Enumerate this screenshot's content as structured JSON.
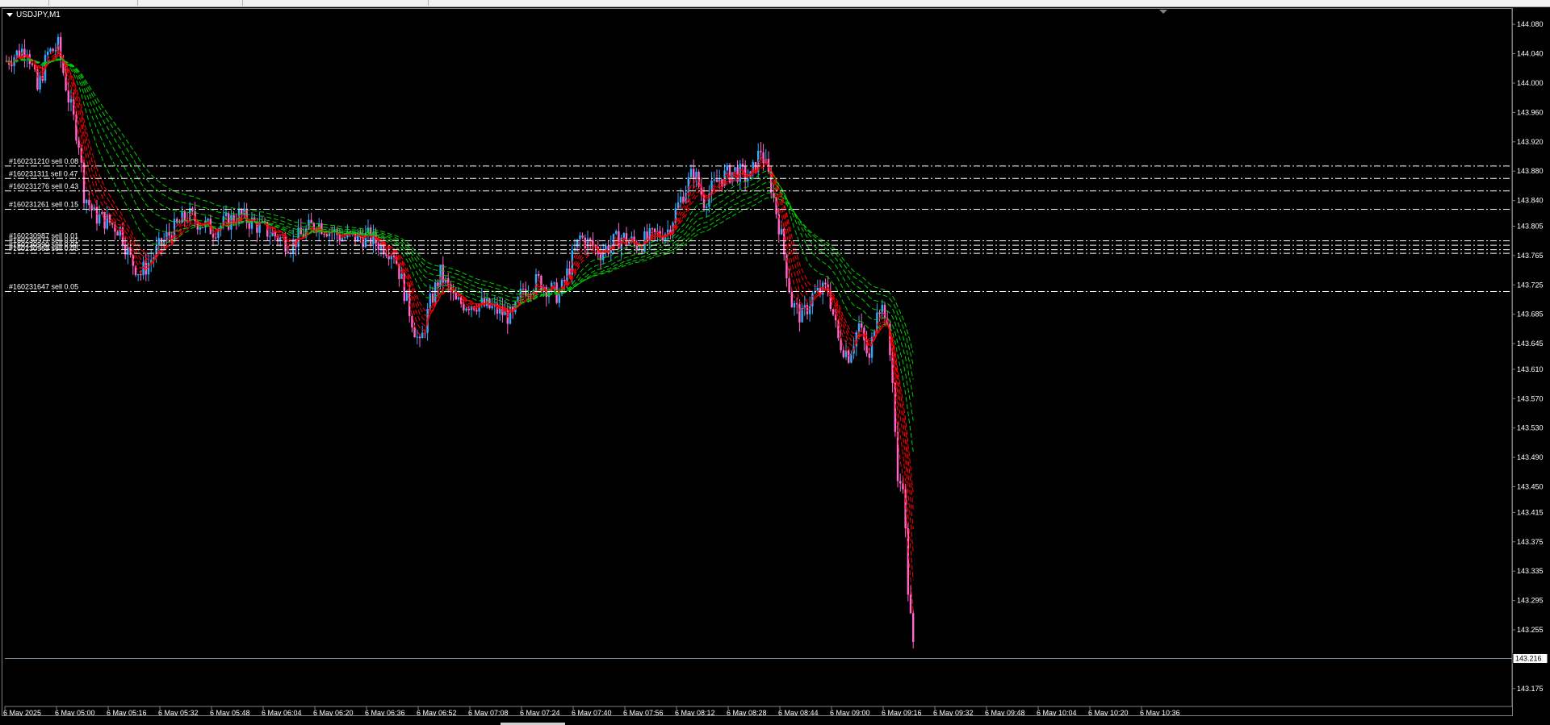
{
  "window": {
    "title": "USDJPY,M1"
  },
  "colors": {
    "background": "#000000",
    "bull": "#33aaff",
    "bear": "#ff66cc",
    "fast_ma": "#ff0000",
    "slow_ma": "#00cc00",
    "order_line": "#ffffff",
    "bid_line": "#778899"
  },
  "orders": [
    {
      "label": "#160231210 sell 0.08",
      "price": 143.887
    },
    {
      "label": "#160231311 sell 0.47",
      "price": 143.87
    },
    {
      "label": "#160231276 sell 0.43",
      "price": 143.853
    },
    {
      "label": "#160231261 sell 0.15",
      "price": 143.828
    },
    {
      "label": "#160230987 sell 0.01",
      "price": 143.785
    },
    {
      "label": "#160230977 sell 0.01",
      "price": 143.779
    },
    {
      "label": "#160230990 sell 0.04",
      "price": 143.773
    },
    {
      "label": "#160230969 sell 0.05",
      "price": 143.768
    },
    {
      "label": "#160231647 sell 0.05",
      "price": 143.716
    }
  ],
  "current_price": "143.216",
  "chart_data": {
    "type": "candlestick",
    "symbol": "USDJPY",
    "timeframe": "M1",
    "ylim": [
      143.155,
      144.1
    ],
    "y_ticks": [
      "144.080",
      "144.040",
      "144.000",
      "143.960",
      "143.920",
      "143.880",
      "143.840",
      "143.805",
      "143.765",
      "143.725",
      "143.685",
      "143.645",
      "143.610",
      "143.570",
      "143.530",
      "143.490",
      "143.450",
      "143.415",
      "143.375",
      "143.335",
      "143.295",
      "143.255",
      "143.175"
    ],
    "x_ticks": [
      "6 May 2025",
      "6 May 05:00",
      "6 May 05:16",
      "6 May 05:32",
      "6 May 05:48",
      "6 May 06:04",
      "6 May 06:20",
      "6 May 06:36",
      "6 May 06:52",
      "6 May 07:08",
      "6 May 07:24",
      "6 May 07:40",
      "6 May 07:56",
      "6 May 08:12",
      "6 May 08:28",
      "6 May 08:44",
      "6 May 09:00",
      "6 May 09:16",
      "6 May 09:32",
      "6 May 09:48",
      "6 May 10:04",
      "6 May 10:20",
      "6 May 10:36"
    ],
    "candle_count": 352,
    "close_path": [
      {
        "i": 0,
        "p": 144.03
      },
      {
        "i": 8,
        "p": 144.05
      },
      {
        "i": 12,
        "p": 143.99
      },
      {
        "i": 16,
        "p": 144.04
      },
      {
        "i": 20,
        "p": 144.05
      },
      {
        "i": 24,
        "p": 143.98
      },
      {
        "i": 28,
        "p": 143.92
      },
      {
        "i": 30,
        "p": 143.85
      },
      {
        "i": 34,
        "p": 143.82
      },
      {
        "i": 40,
        "p": 143.81
      },
      {
        "i": 44,
        "p": 143.8
      },
      {
        "i": 48,
        "p": 143.76
      },
      {
        "i": 52,
        "p": 143.74
      },
      {
        "i": 56,
        "p": 143.76
      },
      {
        "i": 62,
        "p": 143.79
      },
      {
        "i": 70,
        "p": 143.82
      },
      {
        "i": 80,
        "p": 143.8
      },
      {
        "i": 90,
        "p": 143.82
      },
      {
        "i": 100,
        "p": 143.8
      },
      {
        "i": 110,
        "p": 143.78
      },
      {
        "i": 120,
        "p": 143.81
      },
      {
        "i": 130,
        "p": 143.79
      },
      {
        "i": 140,
        "p": 143.79
      },
      {
        "i": 150,
        "p": 143.77
      },
      {
        "i": 156,
        "p": 143.69
      },
      {
        "i": 160,
        "p": 143.64
      },
      {
        "i": 164,
        "p": 143.7
      },
      {
        "i": 168,
        "p": 143.74
      },
      {
        "i": 174,
        "p": 143.7
      },
      {
        "i": 182,
        "p": 143.7
      },
      {
        "i": 190,
        "p": 143.69
      },
      {
        "i": 196,
        "p": 143.68
      },
      {
        "i": 200,
        "p": 143.72
      },
      {
        "i": 206,
        "p": 143.73
      },
      {
        "i": 214,
        "p": 143.71
      },
      {
        "i": 222,
        "p": 143.79
      },
      {
        "i": 230,
        "p": 143.77
      },
      {
        "i": 238,
        "p": 143.79
      },
      {
        "i": 244,
        "p": 143.78
      },
      {
        "i": 250,
        "p": 143.79
      },
      {
        "i": 256,
        "p": 143.8
      },
      {
        "i": 262,
        "p": 143.85
      },
      {
        "i": 266,
        "p": 143.88
      },
      {
        "i": 270,
        "p": 143.84
      },
      {
        "i": 276,
        "p": 143.87
      },
      {
        "i": 282,
        "p": 143.88
      },
      {
        "i": 288,
        "p": 143.87
      },
      {
        "i": 292,
        "p": 143.91
      },
      {
        "i": 296,
        "p": 143.86
      },
      {
        "i": 300,
        "p": 143.79
      },
      {
        "i": 304,
        "p": 143.7
      },
      {
        "i": 308,
        "p": 143.68
      },
      {
        "i": 312,
        "p": 143.71
      },
      {
        "i": 318,
        "p": 143.72
      },
      {
        "i": 322,
        "p": 143.65
      },
      {
        "i": 326,
        "p": 143.63
      },
      {
        "i": 330,
        "p": 143.67
      },
      {
        "i": 334,
        "p": 143.62
      },
      {
        "i": 337,
        "p": 143.7
      },
      {
        "i": 340,
        "p": 143.69
      },
      {
        "i": 343,
        "p": 143.6
      },
      {
        "i": 345,
        "p": 143.45
      },
      {
        "i": 347,
        "p": 143.46
      },
      {
        "i": 349,
        "p": 143.31
      },
      {
        "i": 351,
        "p": 143.23
      }
    ]
  }
}
